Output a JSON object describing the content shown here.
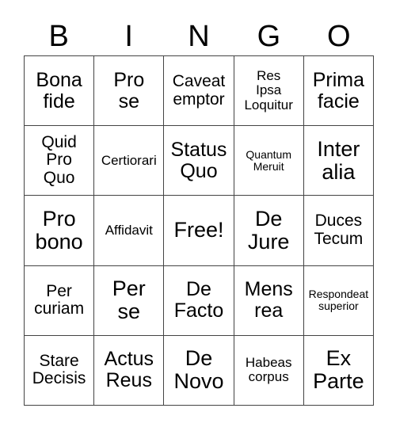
{
  "card": {
    "title": "BINGO",
    "header_letters": [
      "B",
      "I",
      "N",
      "G",
      "O"
    ],
    "free_space_label": "Free!",
    "columns": 5,
    "rows": 5,
    "colors": {
      "background": "#ffffff",
      "cell_background": "#ffffff",
      "border": "#444444",
      "text": "#000000"
    },
    "cells": [
      {
        "text": "Bona\nfide",
        "size": "lg",
        "row": 1,
        "col": 1,
        "free": false
      },
      {
        "text": "Pro\nse",
        "size": "lg",
        "row": 1,
        "col": 2,
        "free": false
      },
      {
        "text": "Caveat\nemptor",
        "size": "md",
        "row": 1,
        "col": 3,
        "free": false
      },
      {
        "text": "Res\nIpsa\nLoquitur",
        "size": "sm",
        "row": 1,
        "col": 4,
        "free": false
      },
      {
        "text": "Prima\nfacie",
        "size": "lg",
        "row": 1,
        "col": 5,
        "free": false
      },
      {
        "text": "Quid\nPro\nQuo",
        "size": "md",
        "row": 2,
        "col": 1,
        "free": false
      },
      {
        "text": "Certiorari",
        "size": "sm",
        "row": 2,
        "col": 2,
        "free": false
      },
      {
        "text": "Status\nQuo",
        "size": "lg",
        "row": 2,
        "col": 3,
        "free": false
      },
      {
        "text": "Quantum\nMeruit",
        "size": "xs",
        "row": 2,
        "col": 4,
        "free": false
      },
      {
        "text": "Inter\nalia",
        "size": "xl",
        "row": 2,
        "col": 5,
        "free": false
      },
      {
        "text": "Pro\nbono",
        "size": "xl",
        "row": 3,
        "col": 1,
        "free": false
      },
      {
        "text": "Affidavit",
        "size": "sm",
        "row": 3,
        "col": 2,
        "free": false
      },
      {
        "text": "Free!",
        "size": "xl",
        "row": 3,
        "col": 3,
        "free": true
      },
      {
        "text": "De\nJure",
        "size": "xl",
        "row": 3,
        "col": 4,
        "free": false
      },
      {
        "text": "Duces\nTecum",
        "size": "md",
        "row": 3,
        "col": 5,
        "free": false
      },
      {
        "text": "Per\ncuriam",
        "size": "md",
        "row": 4,
        "col": 1,
        "free": false
      },
      {
        "text": "Per\nse",
        "size": "xl",
        "row": 4,
        "col": 2,
        "free": false
      },
      {
        "text": "De\nFacto",
        "size": "lg",
        "row": 4,
        "col": 3,
        "free": false
      },
      {
        "text": "Mens\nrea",
        "size": "lg",
        "row": 4,
        "col": 4,
        "free": false
      },
      {
        "text": "Respondeat\nsuperior",
        "size": "xs",
        "row": 4,
        "col": 5,
        "free": false
      },
      {
        "text": "Stare\nDecisis",
        "size": "md",
        "row": 5,
        "col": 1,
        "free": false
      },
      {
        "text": "Actus\nReus",
        "size": "lg",
        "row": 5,
        "col": 2,
        "free": false
      },
      {
        "text": "De\nNovo",
        "size": "xl",
        "row": 5,
        "col": 3,
        "free": false
      },
      {
        "text": "Habeas\ncorpus",
        "size": "sm",
        "row": 5,
        "col": 4,
        "free": false
      },
      {
        "text": "Ex\nParte",
        "size": "xl",
        "row": 5,
        "col": 5,
        "free": false
      }
    ]
  }
}
